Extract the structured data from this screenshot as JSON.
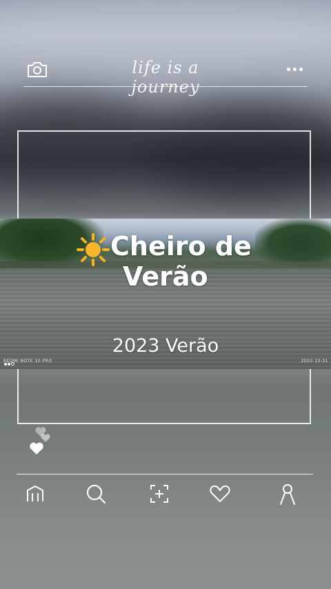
{
  "header": {
    "tagline": "life is a journey",
    "icons": {
      "left": "camera-icon",
      "right": "more-icon"
    }
  },
  "photo": {
    "emoji_icon": "sun-icon",
    "title_line1": "Cheiro de",
    "title_line2": "Verão",
    "subtitle": "2023 Verão",
    "watermark_left": "REDMI NOTE 10 PRO",
    "watermark_right": "2023 13:31"
  },
  "reaction": {
    "icon": "hearts-icon"
  },
  "nav": {
    "items": [
      {
        "name": "home-icon"
      },
      {
        "name": "search-icon"
      },
      {
        "name": "add-icon"
      },
      {
        "name": "like-icon"
      },
      {
        "name": "profile-icon"
      }
    ]
  },
  "colors": {
    "line": "#ffffff",
    "text": "#ffffff",
    "sun": "#f5b223"
  }
}
